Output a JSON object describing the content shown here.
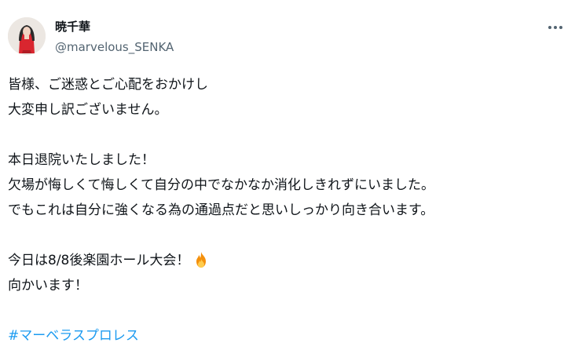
{
  "user": {
    "name": "暁千華",
    "handle": "@marvelous_SENKA"
  },
  "tweet": {
    "lines": [
      "皆様、ご迷惑とご心配をおかけし",
      "大変申し訳ございません。",
      "",
      "本日退院いたしました！",
      "欠場が悔しくて悔しくて自分の中でなかなか消化しきれずにいました。",
      "でもこれは自分に強くなる為の通過点だと思いしっかり向き合います。",
      "",
      "今日は8/8後楽園ホール大会！",
      "向かいます！",
      ""
    ],
    "emoji": "fire-emoji",
    "hashtag": "#マーベラスプロレス"
  },
  "icons": {
    "more": "more-options-icon"
  },
  "colors": {
    "text": "#0f1419",
    "secondary": "#536471",
    "link": "#1d9bf0"
  }
}
